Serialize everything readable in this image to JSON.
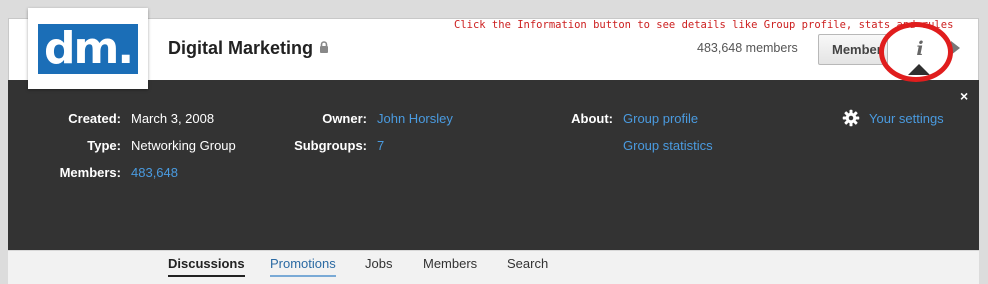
{
  "group": {
    "logo_text": "dm.",
    "name": "Digital Marketing",
    "member_count": "483,648 members",
    "member_button": "Member",
    "info_button": "i",
    "annotation": "Click the Information button to see details like Group profile, stats and rules"
  },
  "info": {
    "close": "×",
    "created_label": "Created:",
    "created_value": "March 3, 2008",
    "type_label": "Type:",
    "type_value": "Networking Group",
    "members_label": "Members:",
    "members_value": "483,648",
    "owner_label": "Owner:",
    "owner_value": "John Horsley",
    "subgroups_label": "Subgroups:",
    "subgroups_value": "7",
    "about_label": "About:",
    "about_links": [
      "Group profile",
      "Group statistics"
    ],
    "settings_link": "Your settings"
  },
  "tabs": [
    "Discussions",
    "Promotions",
    "Jobs",
    "Members",
    "Search"
  ],
  "colors": {
    "logo_blue": "#1b6eb7",
    "panel_bg": "#333333",
    "link_blue": "#4a9be0",
    "annotation_red": "#cc1f1f",
    "circle_red": "#e01d1d"
  },
  "icons": {
    "lock": "lock-icon",
    "gear": "gear-icon",
    "close": "close-icon",
    "next": "chevron-right-icon",
    "info": "info-icon"
  }
}
